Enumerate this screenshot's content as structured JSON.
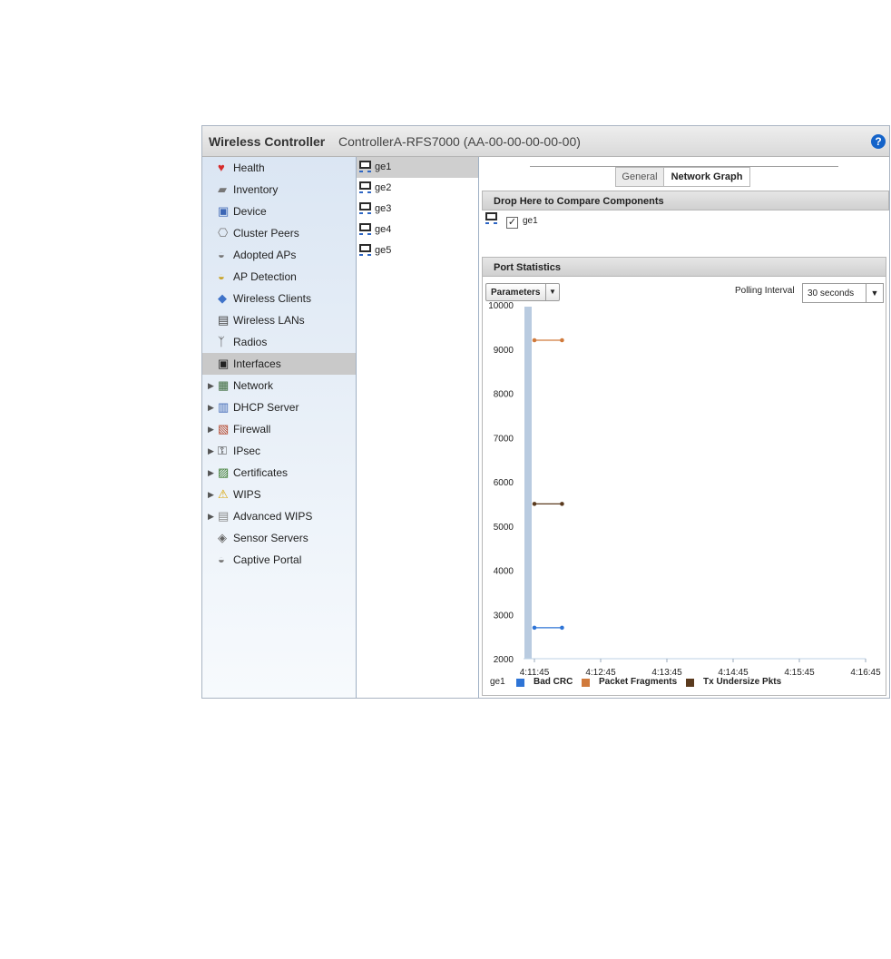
{
  "header": {
    "title": "Wireless Controller",
    "device": "ControllerA-RFS7000 (AA-00-00-00-00-00)",
    "help_icon": "help-icon"
  },
  "nav": {
    "items": [
      {
        "label": "Health",
        "icon": "health-icon",
        "expandable": false,
        "selected": false
      },
      {
        "label": "Inventory",
        "icon": "inventory-icon",
        "expandable": false,
        "selected": false
      },
      {
        "label": "Device",
        "icon": "device-icon",
        "expandable": false,
        "selected": false
      },
      {
        "label": "Cluster Peers",
        "icon": "cluster-peers-icon",
        "expandable": false,
        "selected": false
      },
      {
        "label": "Adopted APs",
        "icon": "adopted-aps-icon",
        "expandable": false,
        "selected": false
      },
      {
        "label": "AP Detection",
        "icon": "ap-detection-icon",
        "expandable": false,
        "selected": false
      },
      {
        "label": "Wireless Clients",
        "icon": "wireless-clients-icon",
        "expandable": false,
        "selected": false
      },
      {
        "label": "Wireless LANs",
        "icon": "wireless-lans-icon",
        "expandable": false,
        "selected": false
      },
      {
        "label": "Radios",
        "icon": "radios-icon",
        "expandable": false,
        "selected": false
      },
      {
        "label": "Interfaces",
        "icon": "interfaces-icon",
        "expandable": false,
        "selected": true
      },
      {
        "label": "Network",
        "icon": "network-icon",
        "expandable": true,
        "selected": false
      },
      {
        "label": "DHCP Server",
        "icon": "dhcp-server-icon",
        "expandable": true,
        "selected": false
      },
      {
        "label": "Firewall",
        "icon": "firewall-icon",
        "expandable": true,
        "selected": false
      },
      {
        "label": "IPsec",
        "icon": "ipsec-icon",
        "expandable": true,
        "selected": false
      },
      {
        "label": "Certificates",
        "icon": "certificates-icon",
        "expandable": true,
        "selected": false
      },
      {
        "label": "WIPS",
        "icon": "wips-icon",
        "expandable": true,
        "selected": false
      },
      {
        "label": "Advanced WIPS",
        "icon": "advanced-wips-icon",
        "expandable": true,
        "selected": false
      },
      {
        "label": "Sensor Servers",
        "icon": "sensor-servers-icon",
        "expandable": false,
        "selected": false
      },
      {
        "label": "Captive Portal",
        "icon": "captive-portal-icon",
        "expandable": false,
        "selected": false
      }
    ]
  },
  "ports": {
    "items": [
      {
        "label": "ge1",
        "selected": true
      },
      {
        "label": "ge2",
        "selected": false
      },
      {
        "label": "ge3",
        "selected": false
      },
      {
        "label": "ge4",
        "selected": false
      },
      {
        "label": "ge5",
        "selected": false
      }
    ]
  },
  "tabs": {
    "general": "General",
    "network_graph": "Network Graph",
    "active": "network_graph"
  },
  "compare": {
    "heading": "Drop Here to Compare Components",
    "component": "ge1",
    "checked": true,
    "check_mark": "✓"
  },
  "stats": {
    "heading": "Port Statistics",
    "parameters_label": "Parameters",
    "polling_label": "Polling Interval",
    "polling_value": "30 seconds"
  },
  "colors": {
    "bad_crc": "#2e74d6",
    "packet_fragments": "#d07a3c",
    "tx_undersize": "#5a3a1e",
    "band": "#b9cbe0"
  },
  "chart_data": {
    "type": "line",
    "x": [
      "4:11:45",
      "4:12:45",
      "4:13:45",
      "4:14:45",
      "4:15:45",
      "4:16:45"
    ],
    "ylim": [
      2000,
      10000
    ],
    "yticks": [
      2000,
      3000,
      4000,
      5000,
      6000,
      7000,
      8000,
      9000,
      10000
    ],
    "legend_prefix": "ge1",
    "legend_position": "bottom",
    "series": [
      {
        "name": "Bad CRC",
        "points": [
          [
            "4:11:45",
            2700
          ],
          [
            "4:12:10",
            2700
          ]
        ]
      },
      {
        "name": "Packet Fragments",
        "points": [
          [
            "4:11:45",
            9200
          ],
          [
            "4:12:10",
            9200
          ]
        ]
      },
      {
        "name": "Tx Undersize Pkts",
        "points": [
          [
            "4:11:45",
            5500
          ],
          [
            "4:12:10",
            5500
          ]
        ]
      }
    ]
  }
}
